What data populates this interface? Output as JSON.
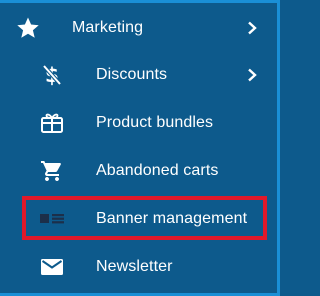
{
  "menu": {
    "parent": {
      "label": "Marketing",
      "icon": "star-icon"
    },
    "items": [
      {
        "label": "Discounts",
        "icon": "discount-icon",
        "has_submenu": true
      },
      {
        "label": "Product bundles",
        "icon": "gift-box-icon"
      },
      {
        "label": "Abandoned carts",
        "icon": "shopping-cart-icon"
      },
      {
        "label": "Banner management",
        "icon": "banner-icon",
        "highlighted": true
      },
      {
        "label": "Newsletter",
        "icon": "mail-icon"
      }
    ]
  },
  "colors": {
    "background": "#0d5a8c",
    "edge_accent": "#1a8fd6",
    "highlight_border": "#e0192a",
    "text": "#ffffff",
    "banner_icon": "#1c2f4a"
  }
}
